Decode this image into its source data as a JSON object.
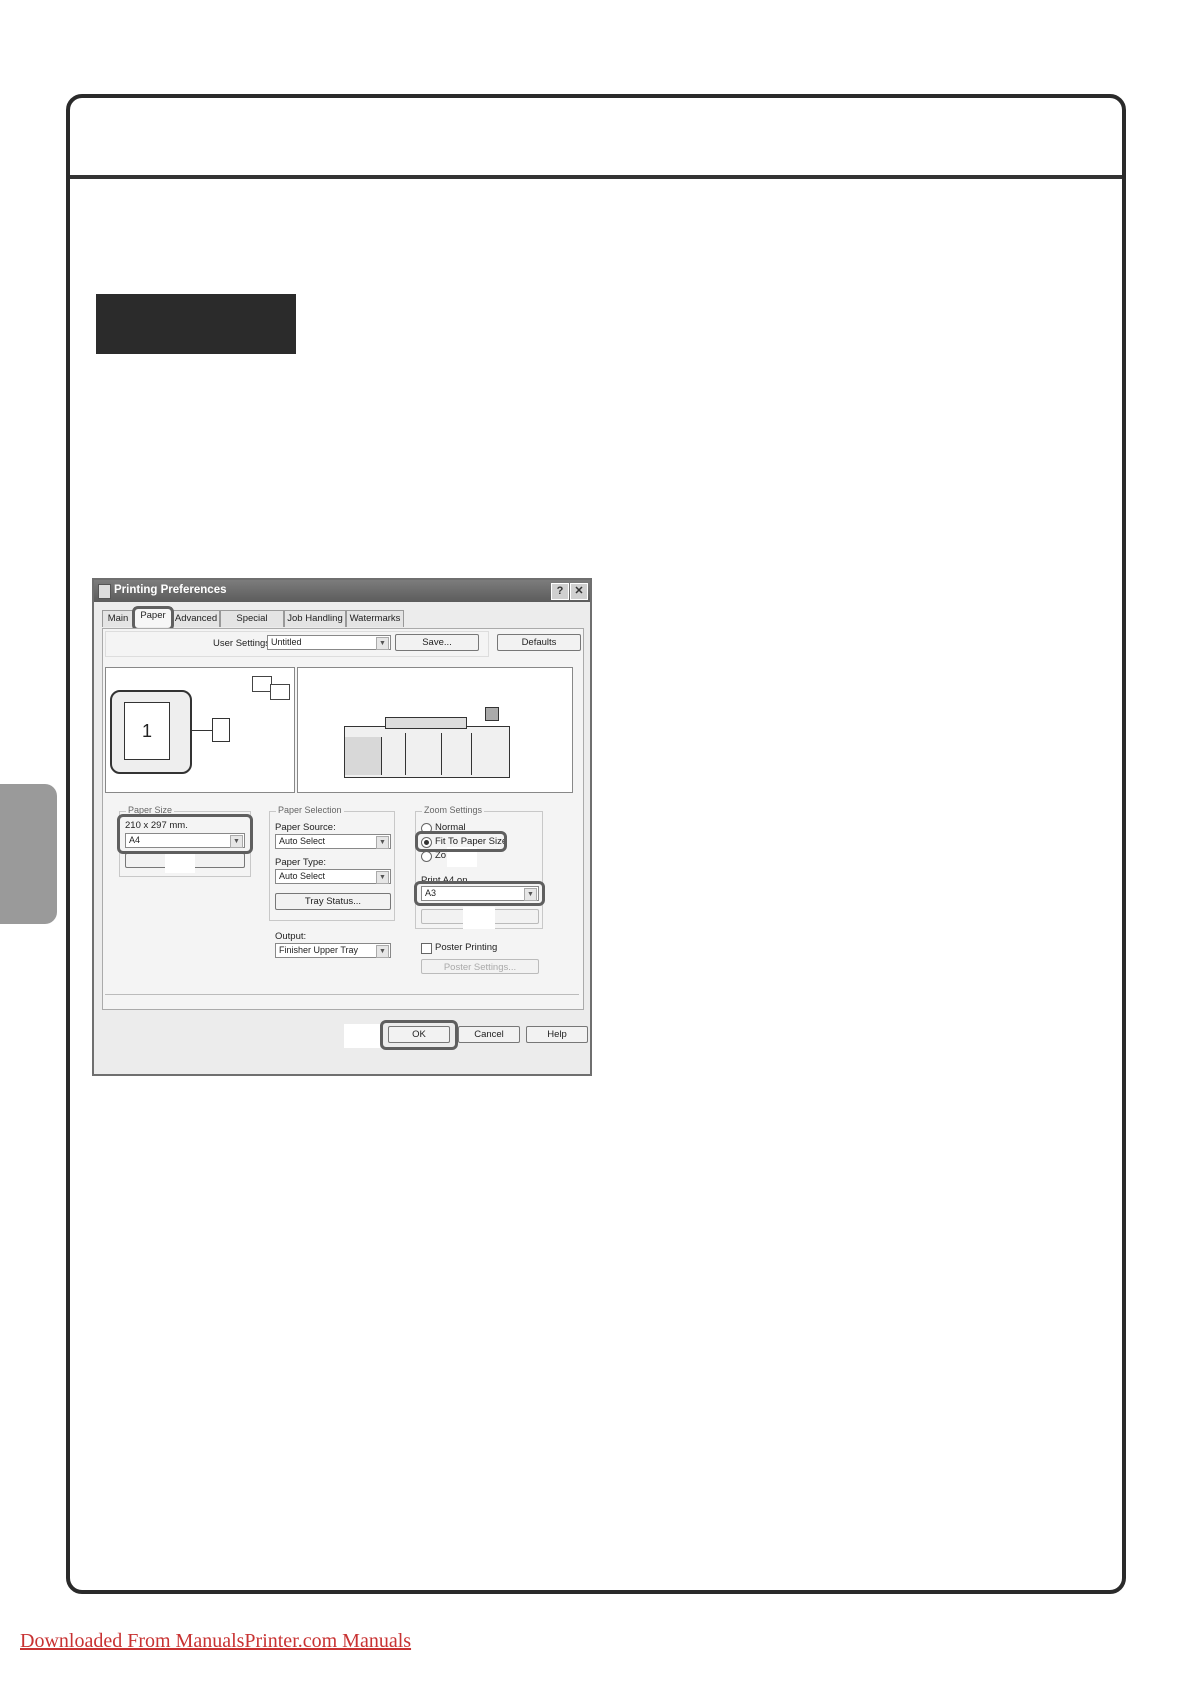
{
  "dialog": {
    "title": "Printing Preferences",
    "help_button": "?",
    "close_button": "✕",
    "tabs": [
      "Main",
      "Paper",
      "Advanced",
      "Special Modes",
      "Job Handling",
      "Watermarks"
    ],
    "active_tab": "Paper",
    "user_settings_label": "User Settings:",
    "user_settings_value": "Untitled",
    "save_button": "Save...",
    "defaults_button": "Defaults",
    "preview_page_number": "1",
    "paper_size": {
      "group_title": "Paper Size",
      "dimensions": "210 x 297 mm.",
      "value": "A4"
    },
    "paper_selection": {
      "group_title": "Paper Selection",
      "source_label": "Paper Source:",
      "source_value": "Auto Select",
      "type_label": "Paper Type:",
      "type_value": "Auto Select",
      "tray_status_button": "Tray Status...",
      "output_label": "Output:",
      "output_value": "Finisher Upper Tray"
    },
    "zoom_settings": {
      "group_title": "Zoom Settings",
      "option_normal": "Normal",
      "option_fit": "Fit To Paper Size",
      "option_zoom": "Zo",
      "fit_label": "Print A4 on",
      "fit_value": "A3",
      "poster_label": "Poster Printing",
      "poster_button": "Poster Settings..."
    },
    "ok_button": "OK",
    "cancel_button": "Cancel",
    "help_footer_button": "Help"
  },
  "footer": {
    "link_text": "Downloaded From ManualsPrinter.com Manuals"
  },
  "colors": {
    "frame": "#2a2a2a",
    "highlight": "#5f5f5f",
    "link": "#c83232"
  }
}
